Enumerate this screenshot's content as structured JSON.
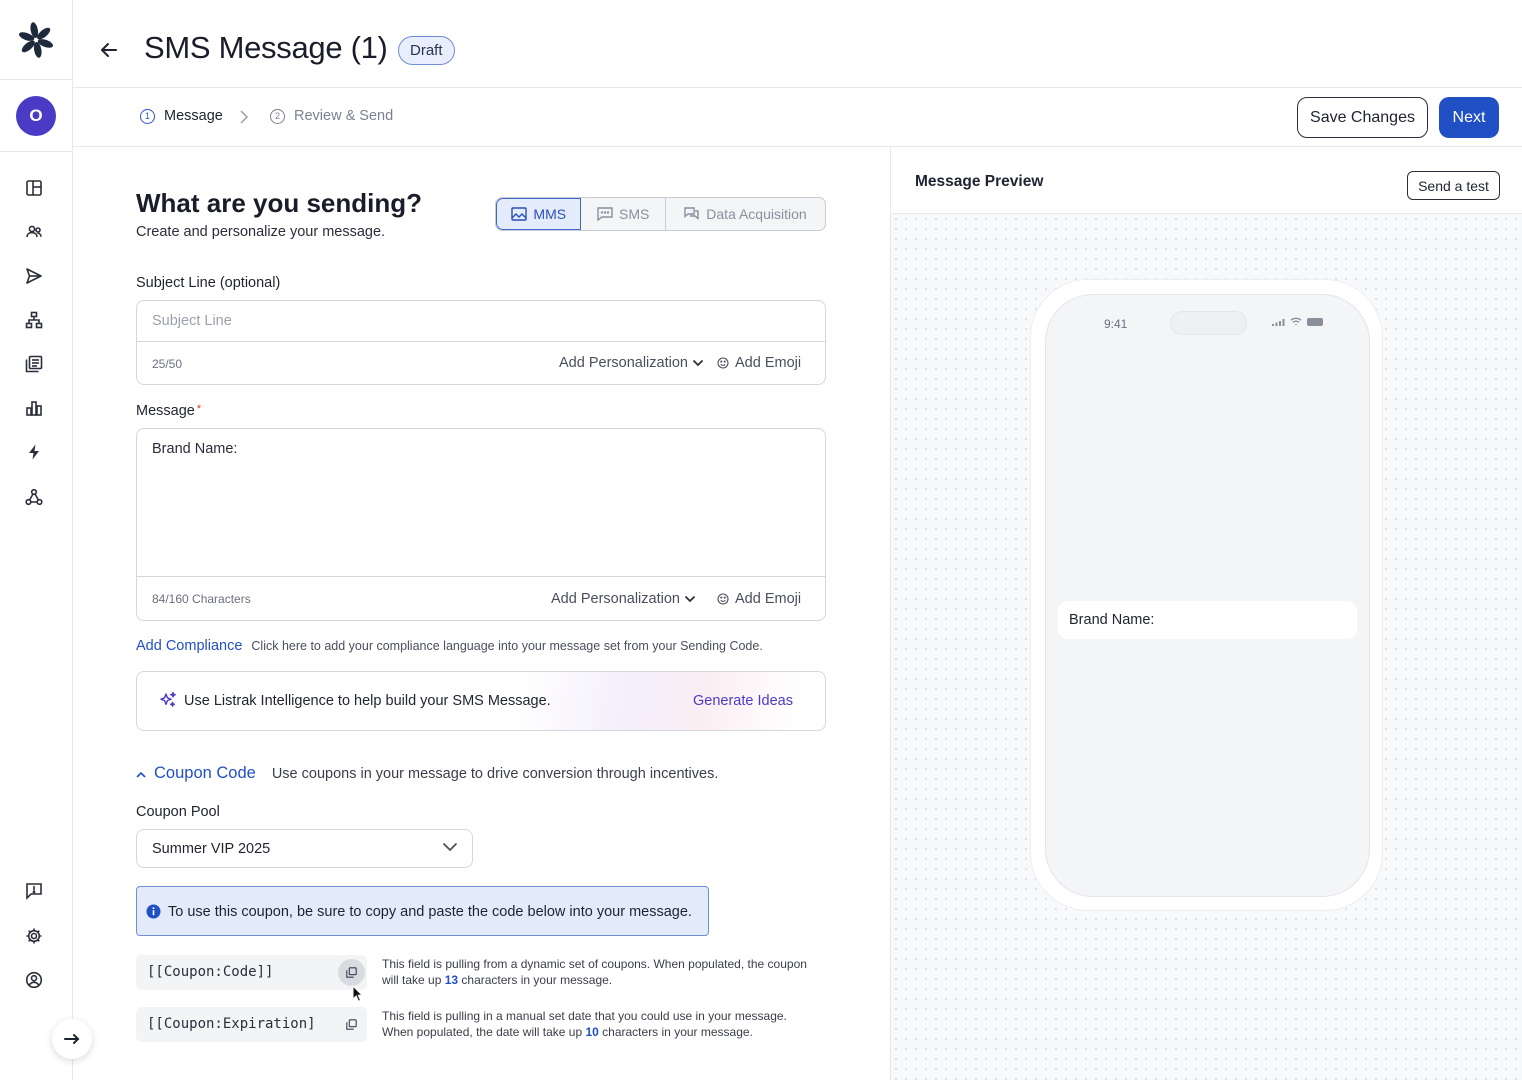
{
  "header": {
    "title": "SMS Message (1)",
    "badge": "Draft"
  },
  "user": {
    "initial": "O"
  },
  "stepper": {
    "steps": [
      {
        "num": "1",
        "label": "Message"
      },
      {
        "num": "2",
        "label": "Review & Send"
      }
    ],
    "save_label": "Save Changes",
    "next_label": "Next"
  },
  "form": {
    "heading": "What are you sending?",
    "subheading": "Create and personalize your message.",
    "types": [
      "MMS",
      "SMS",
      "Data Acquisition"
    ],
    "subject": {
      "label": "Subject Line (optional)",
      "placeholder": "Subject Line",
      "counter": "25/50",
      "add_personalization": "Add Personalization",
      "add_emoji": "Add Emoji"
    },
    "message": {
      "label": "Message",
      "required_mark": "*",
      "text": "Brand Name:",
      "counter": "84/160 Characters",
      "add_personalization": "Add Personalization",
      "add_emoji": "Add Emoji"
    },
    "compliance": {
      "link": "Add Compliance",
      "hint": "Click here to add your compliance language into your message set from your Sending Code."
    },
    "ai": {
      "text": "Use Listrak Intelligence to help build your SMS Message.",
      "action": "Generate Ideas"
    },
    "coupon": {
      "title": "Coupon Code",
      "description": "Use coupons in your message to drive conversion through incentives.",
      "pool_label": "Coupon Pool",
      "pool_value": "Summer VIP 2025",
      "info": "To use this coupon, be sure to copy and paste the code below into your message.",
      "codes": [
        {
          "code": "[[Coupon:Code]]",
          "desc_a": "This field is pulling from a dynamic set of coupons. When populated, the coupon will take up ",
          "count": "13",
          "desc_b": " characters in your message."
        },
        {
          "code": "[[Coupon:Expiration]",
          "desc_a": "This field is pulling in a manual set date that you could use in your message. When populated, the date will take up ",
          "count": "10",
          "desc_b": " characters in your message."
        }
      ]
    }
  },
  "preview": {
    "title": "Message Preview",
    "send_test": "Send a test",
    "time": "9:41",
    "bubble": "Brand Name:"
  },
  "colors": {
    "primary": "#2150c4",
    "avatar": "#4a3bc7",
    "ai_accent": "#4a3bc7",
    "info_bg": "#e3ebfb"
  }
}
